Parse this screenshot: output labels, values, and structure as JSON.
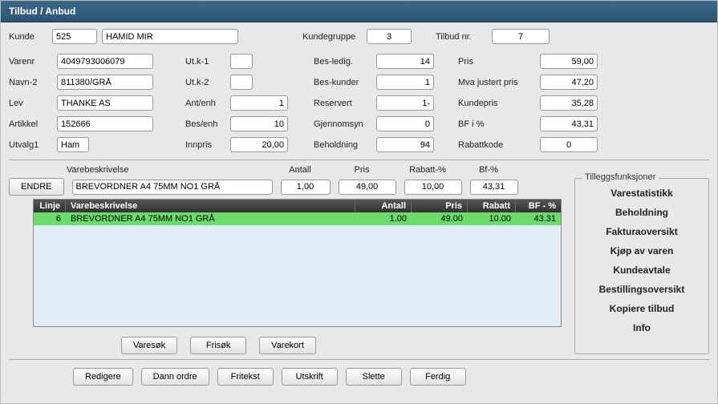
{
  "title": "Tilbud / Anbud",
  "topbar": {
    "kunde_label": "Kunde",
    "kunde_no": "525",
    "kunde_name": "HAMID MIR",
    "kundegruppe_label": "Kundegruppe",
    "kundegruppe": "3",
    "tilbudnr_label": "Tilbud nr.",
    "tilbudnr": "7"
  },
  "left": {
    "varenr_label": "Varenr",
    "varenr": "4049793006079",
    "navn2_label": "Navn-2",
    "navn2": "811380/GRÅ",
    "lev_label": "Lev",
    "lev": "THANKE AS",
    "artikkel_label": "Artikkel",
    "artikkel": "152666",
    "utvalg1_label": "Utvalg1",
    "utvalg1": "Ham"
  },
  "mid": {
    "utk1_label": "Ut.k-1",
    "utk1": "",
    "utk2_label": "Ut.k-2",
    "utk2": "",
    "antenh_label": "Ant/enh",
    "antenh": "1",
    "besenh_label": "Bes/enh",
    "besenh": "10",
    "innpris_label": "Innpris",
    "innpris": "20,00"
  },
  "mid2": {
    "besledig_label": "Bes-ledig.",
    "besledig": "14",
    "beskunder_label": "Bes-kunder",
    "beskunder": "1",
    "reservert_label": "Reservert",
    "reservert": "1-",
    "gjennomsyn_label": "Gjennomsyn",
    "gjennomsyn": "0",
    "beholdning_label": "Beholdning",
    "beholdning": "94"
  },
  "right": {
    "pris_label": "Pris",
    "pris": "59,00",
    "mva_label": "Mva justert pris",
    "mva": "47,20",
    "kundepris_label": "Kundepris",
    "kundepris": "35,28",
    "bfi_label": "BF i %",
    "bfi": "43,31",
    "rabattkode_label": "Rabattkode",
    "rabattkode": "0"
  },
  "editrow": {
    "hdr_varebesk": "Varebeskrivelse",
    "hdr_antall": "Antall",
    "hdr_pris": "Pris",
    "hdr_rabatt": "Rabatt-%",
    "hdr_bf": "Bf-%",
    "endre": "ENDRE",
    "varebesk": "BREVORDNER A4 75MM NO1 GRÅ",
    "antall": "1,00",
    "pris": "49,00",
    "rabatt": "10,00",
    "bf": "43,31"
  },
  "table": {
    "cols": {
      "linje": "Linje",
      "varebesk": "Varebeskrivelse",
      "antall": "Antall",
      "pris": "Pris",
      "rabatt": "Rabatt",
      "bf": "BF - %"
    },
    "row": {
      "linje": "6",
      "varebesk": "BREVORDNER A4 75MM NO1 GRÅ",
      "antall": "1.00",
      "pris": "49.00",
      "rabatt": "10.00",
      "bf": "43.31"
    }
  },
  "side": {
    "legend": "Tilleggsfunksjoner",
    "items": [
      "Varestatistikk",
      "Beholdning",
      "Fakturaoversikt",
      "Kjøp av varen",
      "Kundeavtale",
      "Bestillingsoversikt",
      "Kopiere tilbud",
      "Info"
    ]
  },
  "midbtns": {
    "varesok": "Varesøk",
    "frisok": "Frisøk",
    "varekort": "Varekort"
  },
  "bottom": {
    "redigere": "Redigere",
    "dannordre": "Dann ordre",
    "fritekst": "Fritekst",
    "utskrift": "Utskrift",
    "slette": "Slette",
    "ferdig": "Ferdig"
  }
}
